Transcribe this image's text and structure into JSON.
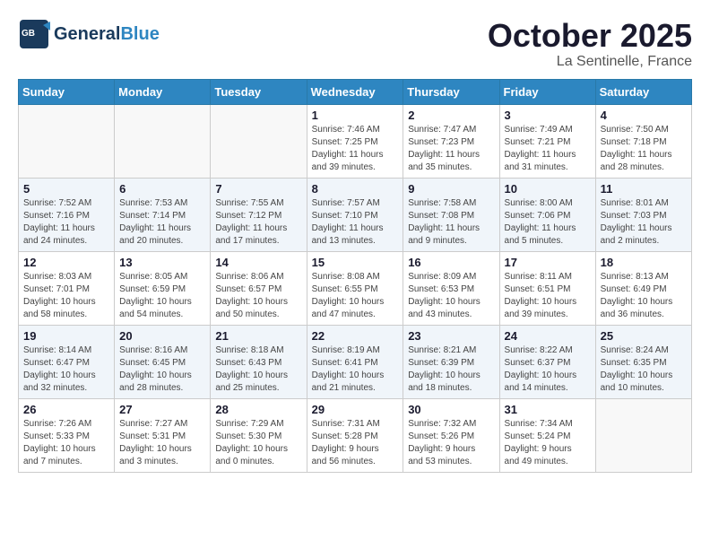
{
  "header": {
    "logo_general": "General",
    "logo_blue": "Blue",
    "month_title": "October 2025",
    "location": "La Sentinelle, France"
  },
  "days_of_week": [
    "Sunday",
    "Monday",
    "Tuesday",
    "Wednesday",
    "Thursday",
    "Friday",
    "Saturday"
  ],
  "weeks": [
    [
      {
        "day": "",
        "info": ""
      },
      {
        "day": "",
        "info": ""
      },
      {
        "day": "",
        "info": ""
      },
      {
        "day": "1",
        "info": "Sunrise: 7:46 AM\nSunset: 7:25 PM\nDaylight: 11 hours\nand 39 minutes."
      },
      {
        "day": "2",
        "info": "Sunrise: 7:47 AM\nSunset: 7:23 PM\nDaylight: 11 hours\nand 35 minutes."
      },
      {
        "day": "3",
        "info": "Sunrise: 7:49 AM\nSunset: 7:21 PM\nDaylight: 11 hours\nand 31 minutes."
      },
      {
        "day": "4",
        "info": "Sunrise: 7:50 AM\nSunset: 7:18 PM\nDaylight: 11 hours\nand 28 minutes."
      }
    ],
    [
      {
        "day": "5",
        "info": "Sunrise: 7:52 AM\nSunset: 7:16 PM\nDaylight: 11 hours\nand 24 minutes."
      },
      {
        "day": "6",
        "info": "Sunrise: 7:53 AM\nSunset: 7:14 PM\nDaylight: 11 hours\nand 20 minutes."
      },
      {
        "day": "7",
        "info": "Sunrise: 7:55 AM\nSunset: 7:12 PM\nDaylight: 11 hours\nand 17 minutes."
      },
      {
        "day": "8",
        "info": "Sunrise: 7:57 AM\nSunset: 7:10 PM\nDaylight: 11 hours\nand 13 minutes."
      },
      {
        "day": "9",
        "info": "Sunrise: 7:58 AM\nSunset: 7:08 PM\nDaylight: 11 hours\nand 9 minutes."
      },
      {
        "day": "10",
        "info": "Sunrise: 8:00 AM\nSunset: 7:06 PM\nDaylight: 11 hours\nand 5 minutes."
      },
      {
        "day": "11",
        "info": "Sunrise: 8:01 AM\nSunset: 7:03 PM\nDaylight: 11 hours\nand 2 minutes."
      }
    ],
    [
      {
        "day": "12",
        "info": "Sunrise: 8:03 AM\nSunset: 7:01 PM\nDaylight: 10 hours\nand 58 minutes."
      },
      {
        "day": "13",
        "info": "Sunrise: 8:05 AM\nSunset: 6:59 PM\nDaylight: 10 hours\nand 54 minutes."
      },
      {
        "day": "14",
        "info": "Sunrise: 8:06 AM\nSunset: 6:57 PM\nDaylight: 10 hours\nand 50 minutes."
      },
      {
        "day": "15",
        "info": "Sunrise: 8:08 AM\nSunset: 6:55 PM\nDaylight: 10 hours\nand 47 minutes."
      },
      {
        "day": "16",
        "info": "Sunrise: 8:09 AM\nSunset: 6:53 PM\nDaylight: 10 hours\nand 43 minutes."
      },
      {
        "day": "17",
        "info": "Sunrise: 8:11 AM\nSunset: 6:51 PM\nDaylight: 10 hours\nand 39 minutes."
      },
      {
        "day": "18",
        "info": "Sunrise: 8:13 AM\nSunset: 6:49 PM\nDaylight: 10 hours\nand 36 minutes."
      }
    ],
    [
      {
        "day": "19",
        "info": "Sunrise: 8:14 AM\nSunset: 6:47 PM\nDaylight: 10 hours\nand 32 minutes."
      },
      {
        "day": "20",
        "info": "Sunrise: 8:16 AM\nSunset: 6:45 PM\nDaylight: 10 hours\nand 28 minutes."
      },
      {
        "day": "21",
        "info": "Sunrise: 8:18 AM\nSunset: 6:43 PM\nDaylight: 10 hours\nand 25 minutes."
      },
      {
        "day": "22",
        "info": "Sunrise: 8:19 AM\nSunset: 6:41 PM\nDaylight: 10 hours\nand 21 minutes."
      },
      {
        "day": "23",
        "info": "Sunrise: 8:21 AM\nSunset: 6:39 PM\nDaylight: 10 hours\nand 18 minutes."
      },
      {
        "day": "24",
        "info": "Sunrise: 8:22 AM\nSunset: 6:37 PM\nDaylight: 10 hours\nand 14 minutes."
      },
      {
        "day": "25",
        "info": "Sunrise: 8:24 AM\nSunset: 6:35 PM\nDaylight: 10 hours\nand 10 minutes."
      }
    ],
    [
      {
        "day": "26",
        "info": "Sunrise: 7:26 AM\nSunset: 5:33 PM\nDaylight: 10 hours\nand 7 minutes."
      },
      {
        "day": "27",
        "info": "Sunrise: 7:27 AM\nSunset: 5:31 PM\nDaylight: 10 hours\nand 3 minutes."
      },
      {
        "day": "28",
        "info": "Sunrise: 7:29 AM\nSunset: 5:30 PM\nDaylight: 10 hours\nand 0 minutes."
      },
      {
        "day": "29",
        "info": "Sunrise: 7:31 AM\nSunset: 5:28 PM\nDaylight: 9 hours\nand 56 minutes."
      },
      {
        "day": "30",
        "info": "Sunrise: 7:32 AM\nSunset: 5:26 PM\nDaylight: 9 hours\nand 53 minutes."
      },
      {
        "day": "31",
        "info": "Sunrise: 7:34 AM\nSunset: 5:24 PM\nDaylight: 9 hours\nand 49 minutes."
      },
      {
        "day": "",
        "info": ""
      }
    ]
  ]
}
